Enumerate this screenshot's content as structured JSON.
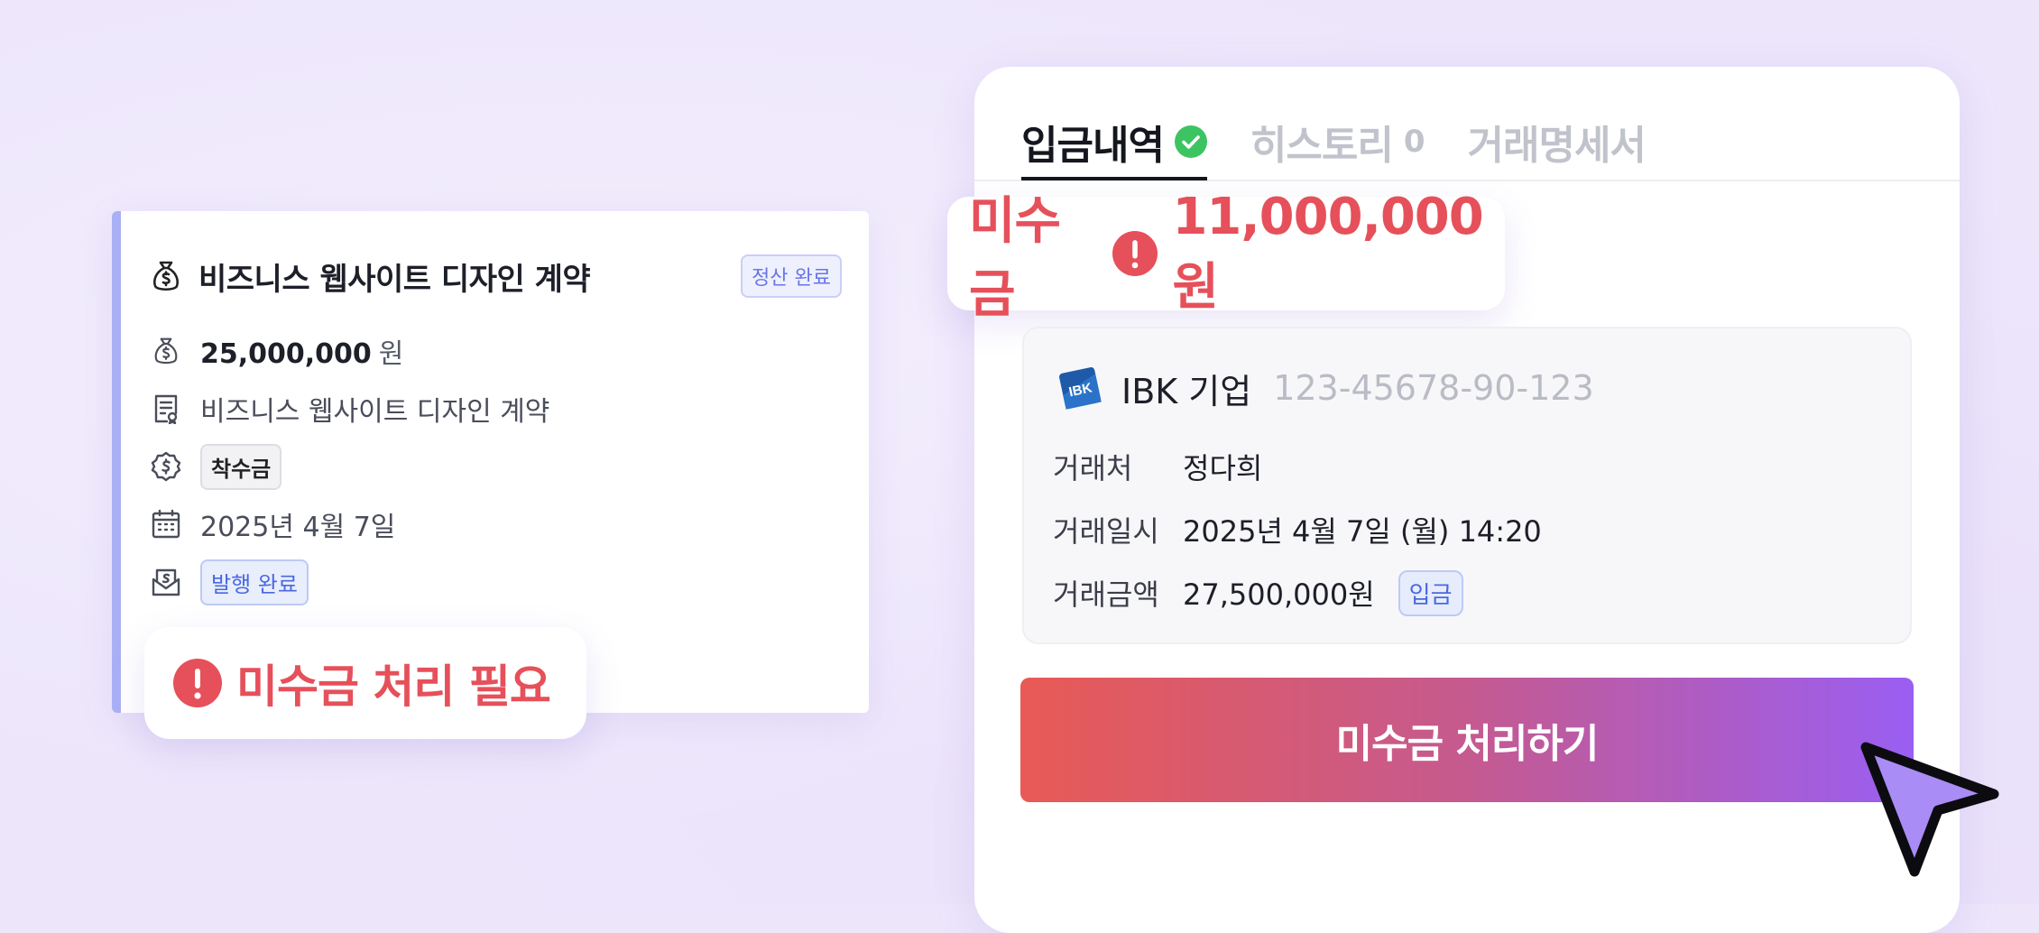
{
  "contract_card": {
    "title": "비즈니스 웹사이트 디자인 계약",
    "status_badge": "정산 완료",
    "amount": "25,000,000",
    "amount_unit": "원",
    "contract_name": "비즈니스 웹사이트 디자인 계약",
    "payment_type": "착수금",
    "date": "2025년 4월 7일",
    "invoice_status": "발행 완료",
    "accent_color": "#aab0f5"
  },
  "unpaid_notice": {
    "text": "미수금 처리 필요",
    "color": "#e6505a"
  },
  "panel": {
    "tabs": [
      {
        "label": "입금내역",
        "active": true,
        "icon": "check-circle-icon"
      },
      {
        "label": "히스토리",
        "count": "0",
        "active": false
      },
      {
        "label": "거래명세서",
        "active": false
      }
    ],
    "unpaid": {
      "label": "미수금",
      "amount": "11,000,000원"
    },
    "transaction": {
      "bank_name": "IBK 기업",
      "bank_logo_text": "IBK",
      "account_number": "123-45678-90-123",
      "rows": [
        {
          "key": "거래처",
          "value": "정다희"
        },
        {
          "key": "거래일시",
          "value": "2025년 4월 7일 (월) 14:20"
        },
        {
          "key": "거래금액",
          "value": "27,500,000원",
          "badge": "입금"
        }
      ]
    },
    "cta_label": "미수금 처리하기"
  },
  "colors": {
    "background": "#ede6fb",
    "alert_red": "#e6505a",
    "success_green": "#3cc463",
    "badge_blue": "#4a68e0",
    "cta_gradient_start": "#e85a55",
    "cta_gradient_end": "#9a5ef2",
    "cursor_fill": "#a98cf5"
  }
}
